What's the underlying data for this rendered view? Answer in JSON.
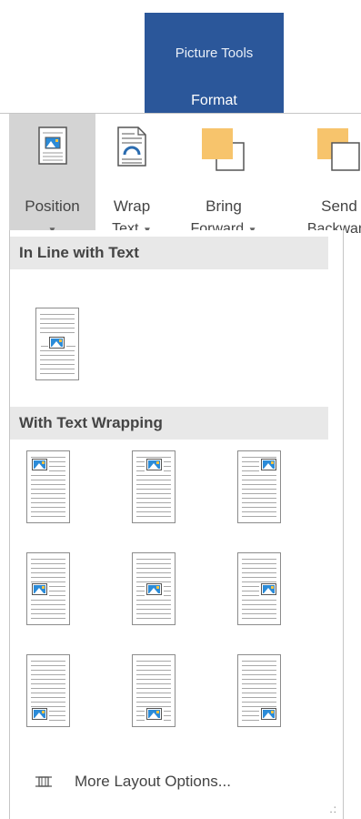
{
  "context_tab": {
    "group": "Picture Tools",
    "tab": "Format",
    "color": "#2b579a"
  },
  "ribbon": {
    "position": {
      "label": "Position"
    },
    "wrap_text": {
      "line1": "Wrap",
      "line2": "Text"
    },
    "bring_forward": {
      "line1": "Bring",
      "line2": "Forward"
    },
    "send_backward": {
      "line1": "Send",
      "line2": "Backward"
    }
  },
  "menu": {
    "inline_header": "In Line with Text",
    "wrapping_header": "With Text Wrapping",
    "more_options": "More Layout Options...",
    "items": [
      "In Line with Text",
      "Position in Top Left with Square Text Wrapping",
      "Position in Top Center with Square Text Wrapping",
      "Position in Top Right with Square Text Wrapping",
      "Position in Middle Left with Square Text Wrapping",
      "Position in Middle Center with Square Text Wrapping",
      "Position in Middle Right with Square Text Wrapping",
      "Position in Bottom Left with Square Text Wrapping",
      "Position in Bottom Center with Square Text Wrapping",
      "Position in Bottom Right with Square Text Wrapping"
    ]
  }
}
